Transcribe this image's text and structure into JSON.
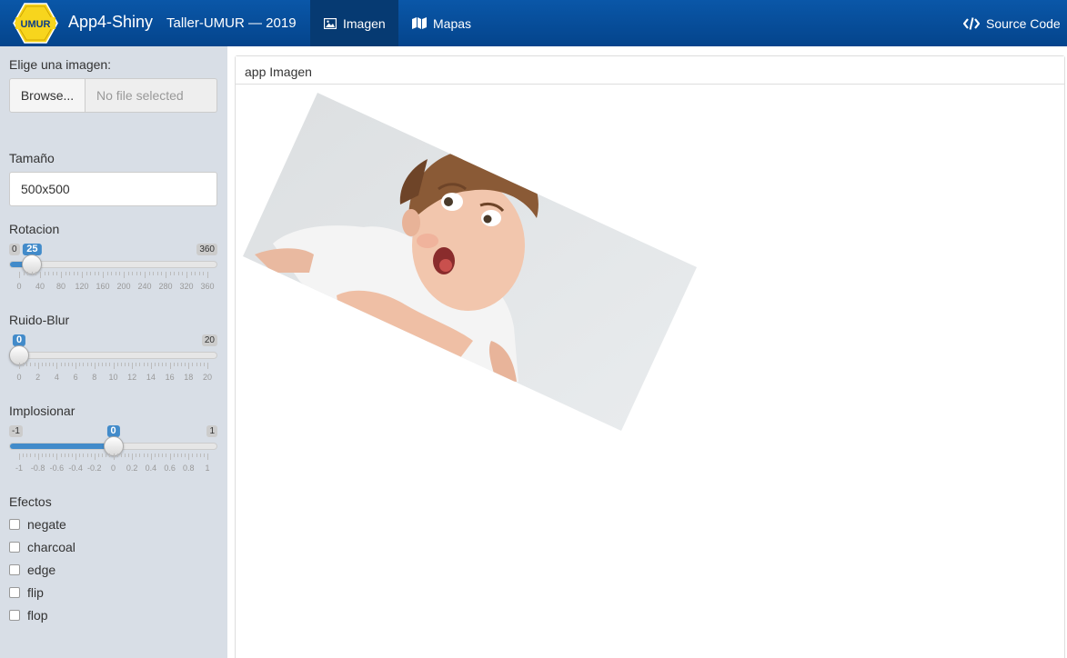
{
  "header": {
    "logo_text": "UMUR",
    "app_title": "App4-Shiny",
    "subtitle": "Taller-UMUR — 2019",
    "tabs": [
      {
        "label": "Imagen",
        "icon": "image-icon",
        "active": true
      },
      {
        "label": "Mapas",
        "icon": "map-icon",
        "active": false
      }
    ],
    "source_code": "Source Code"
  },
  "sidebar": {
    "file_label": "Elige una imagen:",
    "browse_label": "Browse...",
    "file_placeholder": "No file selected",
    "size_label": "Tamaño",
    "size_value": "500x500",
    "sliders": [
      {
        "label": "Rotacion",
        "min": 0,
        "max": 360,
        "value": 25,
        "min_label": "0",
        "max_label": "360",
        "value_label": "25",
        "ticks": [
          "0",
          "40",
          "80",
          "120",
          "160",
          "200",
          "240",
          "280",
          "320",
          "360"
        ]
      },
      {
        "label": "Ruido-Blur",
        "min": 0,
        "max": 20,
        "value": 0,
        "min_label": "",
        "max_label": "20",
        "value_label": "0",
        "ticks": [
          "0",
          "2",
          "4",
          "6",
          "8",
          "10",
          "12",
          "14",
          "16",
          "18",
          "20"
        ]
      },
      {
        "label": "Implosionar",
        "min": -1,
        "max": 1,
        "value": 0,
        "min_label": "-1",
        "max_label": "1",
        "value_label": "0",
        "ticks": [
          "-1",
          "-0.8",
          "-0.6",
          "-0.4",
          "-0.2",
          "0",
          "0.2",
          "0.4",
          "0.6",
          "0.8",
          "1"
        ]
      }
    ],
    "effects_label": "Efectos",
    "effects": [
      "negate",
      "charcoal",
      "edge",
      "flip",
      "flop"
    ]
  },
  "main": {
    "panel_title": "app Imagen",
    "image": {
      "rotation_degrees": 25,
      "description_icon": "child-photo-icon"
    }
  },
  "colors": {
    "header": "#04448c",
    "sidebar": "#d8dee6",
    "accent": "#428bca"
  }
}
